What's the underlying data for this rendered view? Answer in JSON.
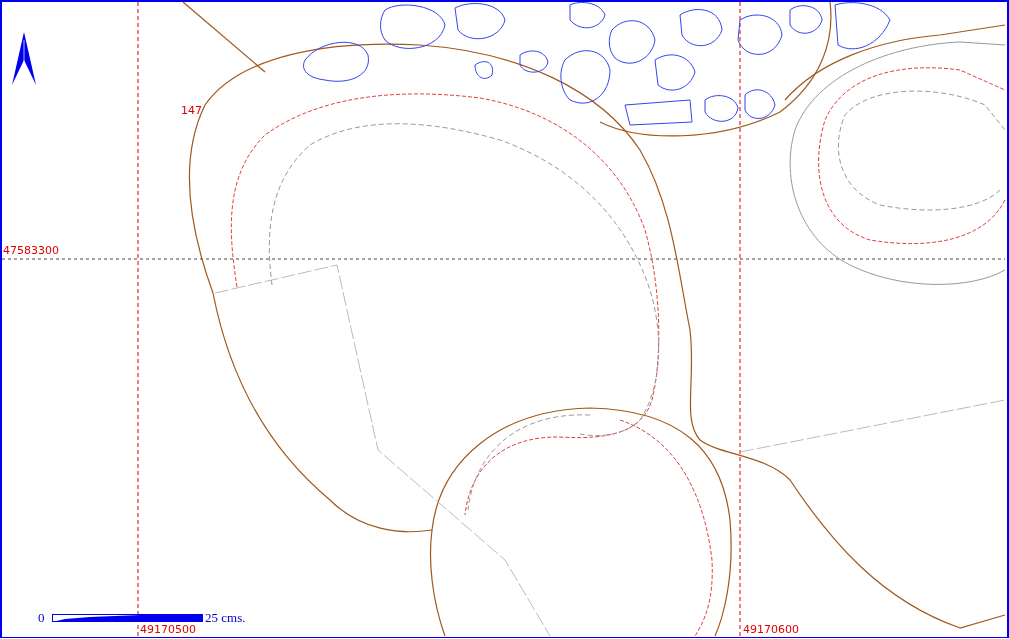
{
  "map": {
    "contour_label": "147",
    "northing_label": "47583300",
    "easting_labels": [
      "49170500",
      "49170600"
    ]
  },
  "scale_bar": {
    "start": "0",
    "end": "25 cms."
  }
}
